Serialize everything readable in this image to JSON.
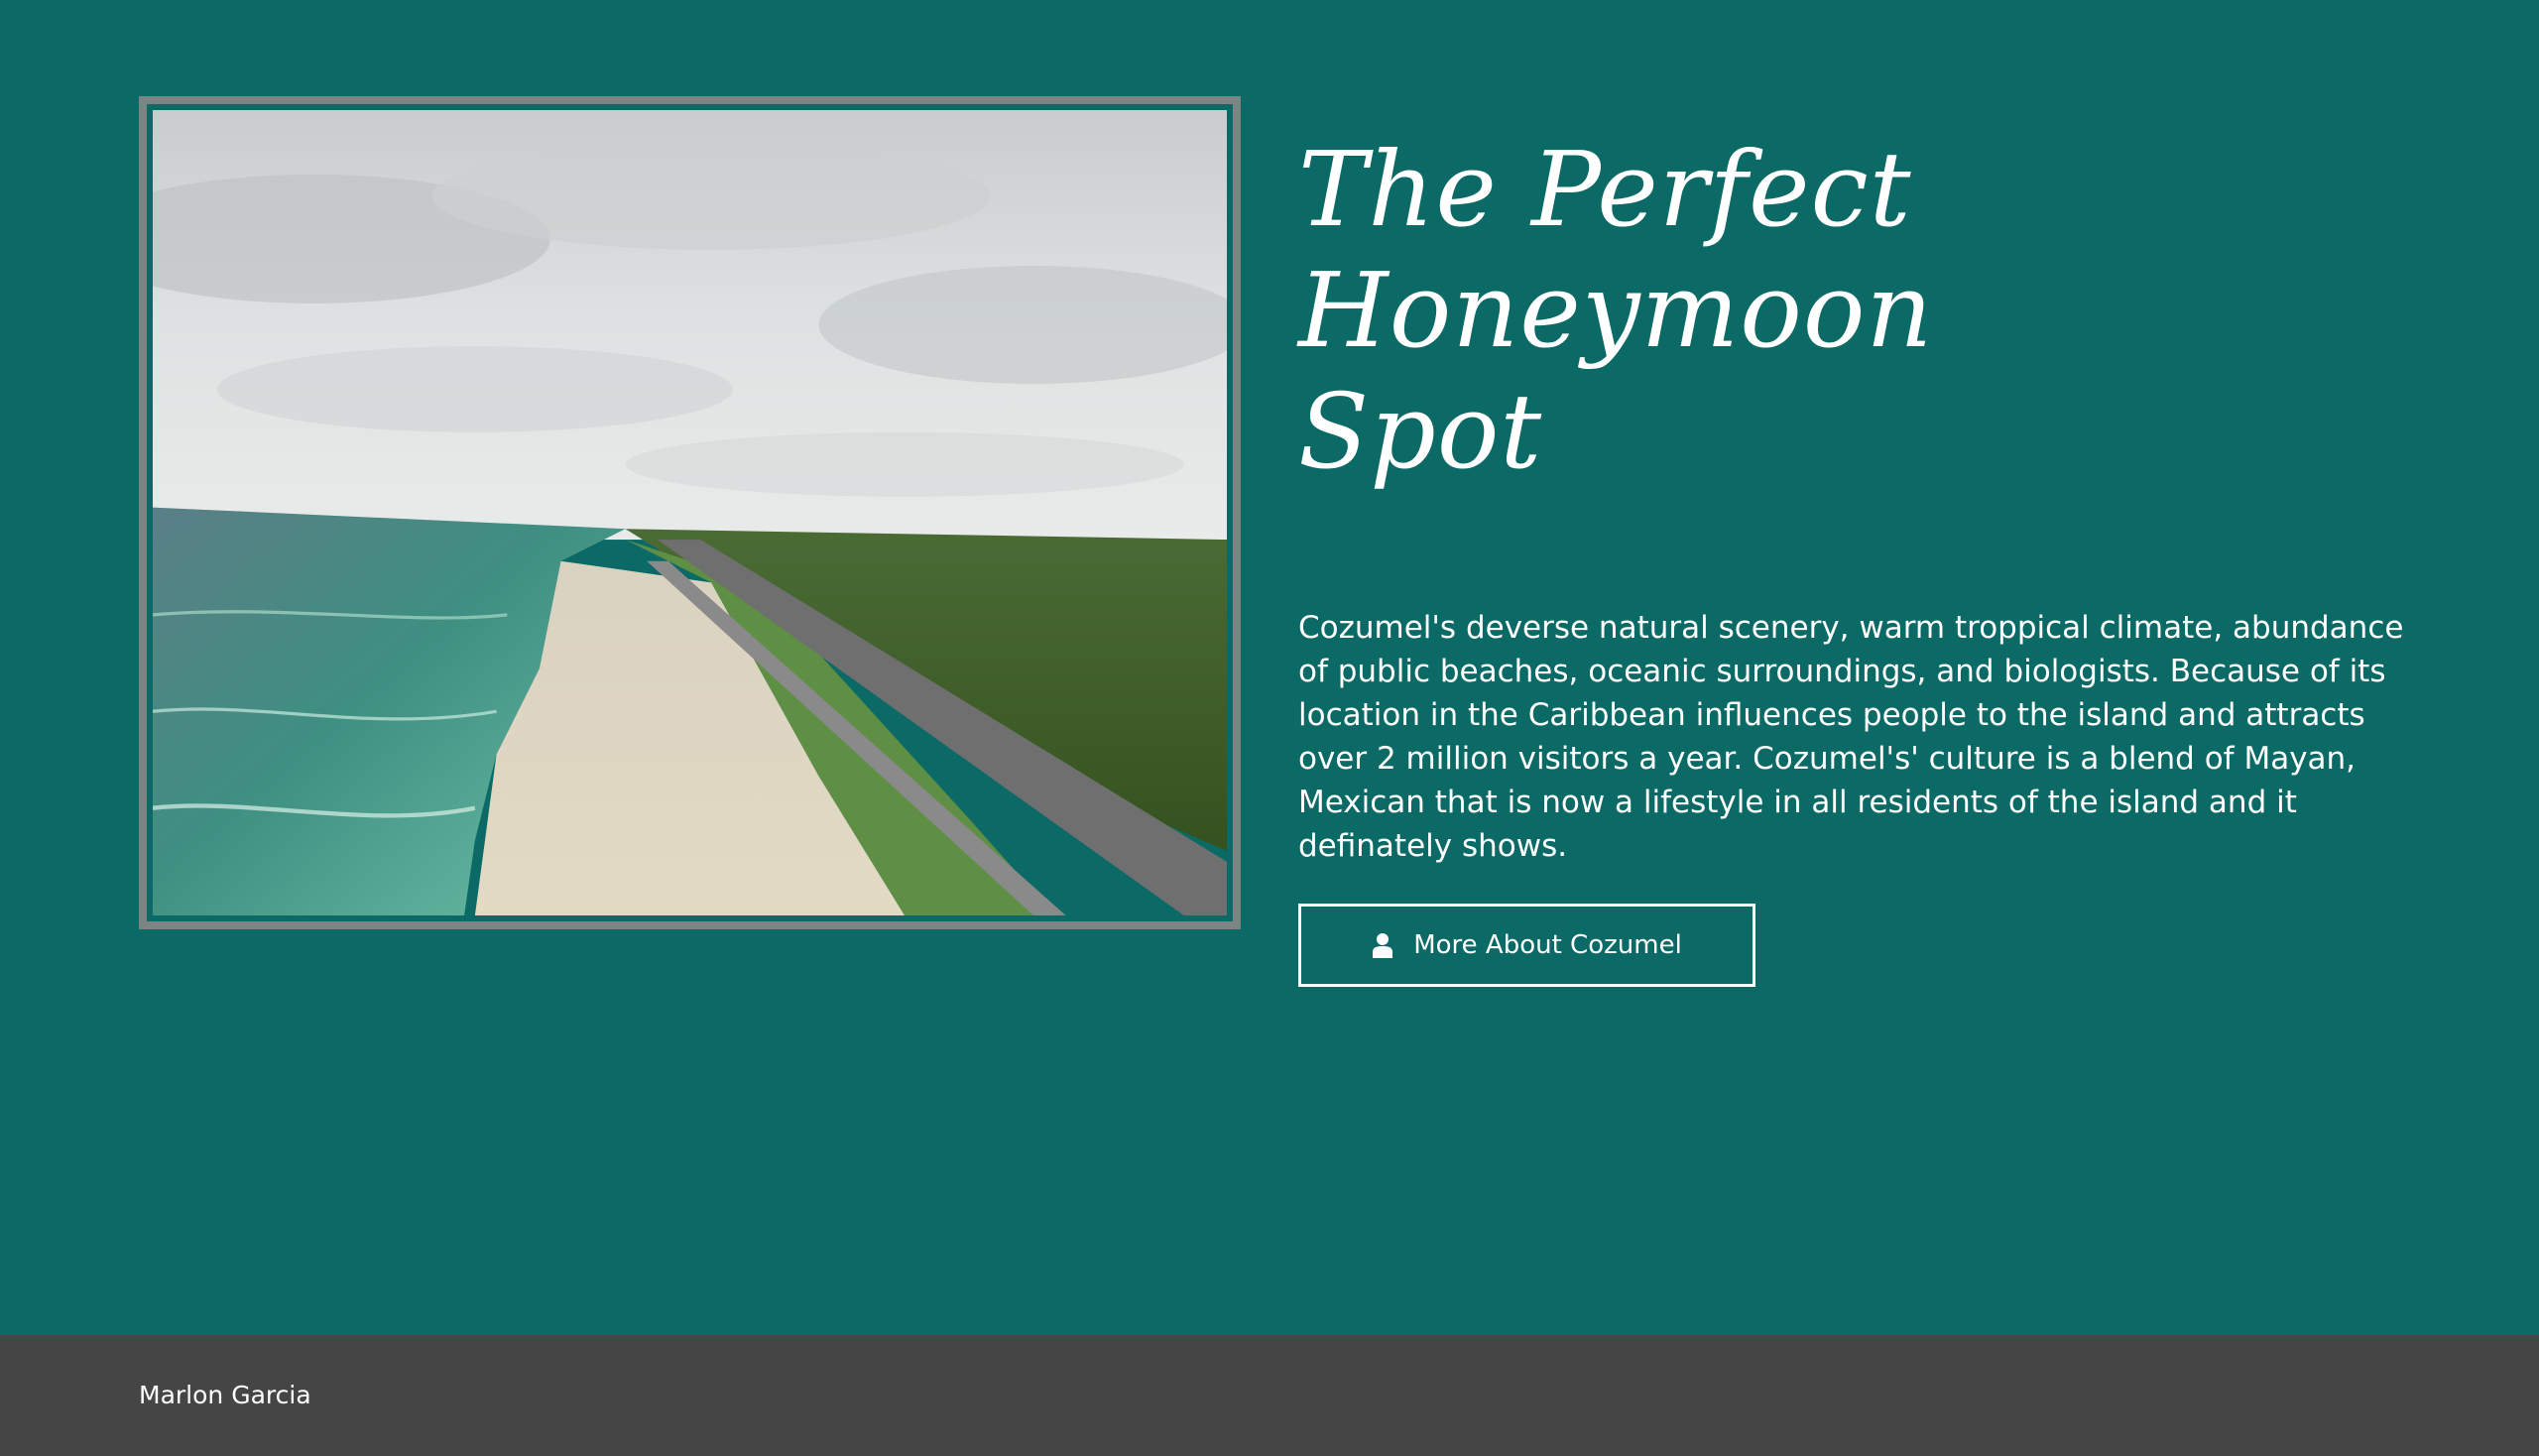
{
  "hero": {
    "image_alt": "Aerial view of the Cozumel coastline",
    "title_line1": "The Perfect Honeymoon",
    "title_line2": "Spot",
    "description": "Cozumel's deverse natural scenery, warm troppical climate, abundance of public beaches, oceanic surroundings, and biologists. Because of its location in the Caribbean influences people to the island and attracts over 2 million visitors a year. Cozumel's' culture is a blend of Mayan, Mexican that is now a lifestyle in all residents of the island and it definately shows.",
    "button_label": "More About Cozumel",
    "button_icon": "user-icon"
  },
  "footer": {
    "name": "Marlon Garcia"
  },
  "colors": {
    "background": "#0b6a66",
    "frame": "#7c8584",
    "footer": "#454545",
    "text": "#ffffff"
  }
}
